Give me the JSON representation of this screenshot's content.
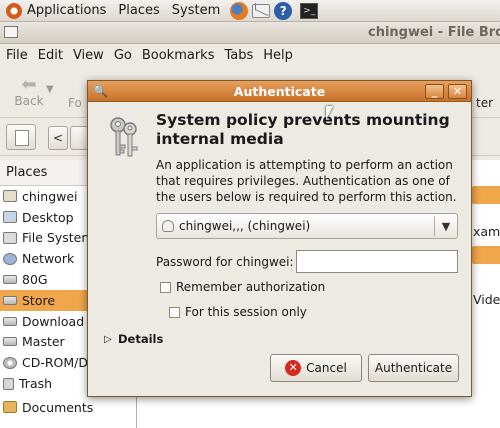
{
  "topbar": {
    "applications": "Applications",
    "places": "Places",
    "system": "System"
  },
  "file_browser": {
    "title": "chingwei - File Brows",
    "menu": [
      "File",
      "Edit",
      "View",
      "Go",
      "Bookmarks",
      "Tabs",
      "Help"
    ],
    "toolbar": {
      "back": "Back",
      "forward_partial": "Fo",
      "terminal_partial": "ter"
    },
    "places_header": "Places",
    "places": [
      {
        "label": "chingwei",
        "icon": "home-folder-icon"
      },
      {
        "label": "Desktop",
        "icon": "desktop-icon"
      },
      {
        "label": "File System",
        "icon": "filesystem-icon"
      },
      {
        "label": "Network",
        "icon": "network-icon"
      },
      {
        "label": "80G",
        "icon": "drive-icon"
      },
      {
        "label": "Store",
        "icon": "drive-icon",
        "selected": true
      },
      {
        "label": "Download",
        "icon": "drive-icon"
      },
      {
        "label": "Master",
        "icon": "drive-icon"
      },
      {
        "label": "CD-ROM/D...",
        "icon": "cdrom-icon"
      },
      {
        "label": "Trash",
        "icon": "trash-icon"
      },
      {
        "label": "Documents",
        "icon": "folder-icon"
      }
    ],
    "content_partial": [
      "xamp",
      "Vide"
    ]
  },
  "dialog": {
    "title": "Authenticate",
    "heading": "System policy prevents mounting internal media",
    "body": "An application is attempting to perform an action that requires privileges. Authentication as one of the users below is required to perform this action.",
    "user_select": "chingwei,,, (chingwei)",
    "password_label": "Password for chingwei:",
    "password_value": "",
    "remember_label": "Remember authorization",
    "session_label": "For this session only",
    "details_label": "Details",
    "cancel_label": "Cancel",
    "authenticate_label": "Authenticate",
    "accent_color": "#d6863d"
  }
}
